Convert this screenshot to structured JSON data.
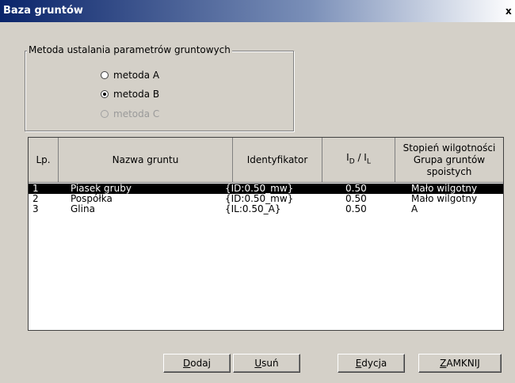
{
  "window": {
    "title": "Baza gruntów",
    "close_label": "x"
  },
  "method_group": {
    "legend": "Metoda ustalania parametrów gruntowych",
    "options": [
      {
        "label": "metoda A",
        "selected": false,
        "disabled": false
      },
      {
        "label": "metoda B",
        "selected": true,
        "disabled": false
      },
      {
        "label": "metoda C",
        "selected": false,
        "disabled": true
      }
    ]
  },
  "table": {
    "headers": {
      "lp": "Lp.",
      "name": "Nazwa gruntu",
      "id": "Identyfikator",
      "idl_main1": "I",
      "idl_sub1": "D",
      "idl_sep": " / ",
      "idl_main2": "I",
      "idl_sub2": "L",
      "stopien_line1": "Stopień wilgotności",
      "stopien_line2": "Grupa gruntów spoistych"
    },
    "rows": [
      {
        "lp": "1",
        "name": "Piasek gruby",
        "id": "{ID:0.50_mw}",
        "value": "0.50",
        "stopien": "Mało wilgotny",
        "selected": true
      },
      {
        "lp": "2",
        "name": "Pospółka",
        "id": "{ID:0.50_mw}",
        "value": "0.50",
        "stopien": "Mało wilgotny",
        "selected": false
      },
      {
        "lp": "3",
        "name": "Glina",
        "id": "{IL:0.50_A}",
        "value": "0.50",
        "stopien": "A",
        "selected": false
      }
    ]
  },
  "buttons": {
    "dodaj_first": "D",
    "dodaj_rest": "odaj",
    "usun_first": "U",
    "usun_rest": "suń",
    "edycja_first": "E",
    "edycja_rest": "dycja",
    "zamknij_first": "Z",
    "zamknij_rest": "AMKNIJ"
  }
}
